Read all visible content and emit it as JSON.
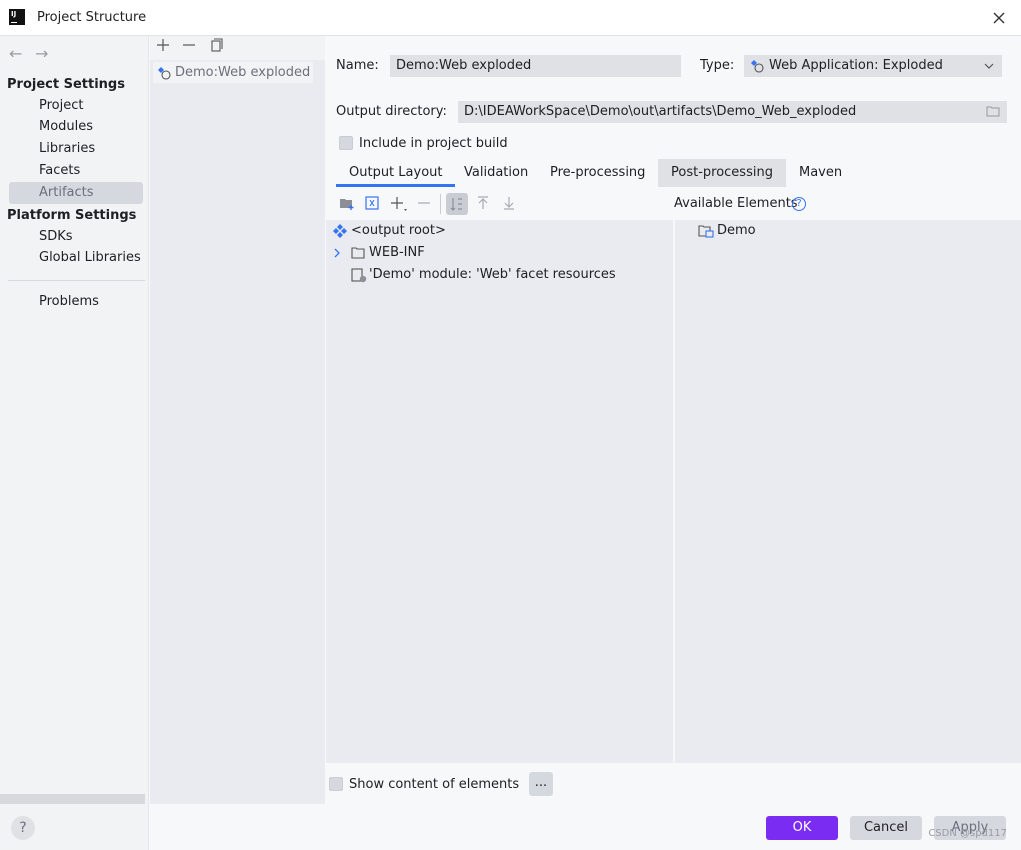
{
  "window": {
    "title": "Project Structure"
  },
  "nav": {
    "project_settings": "Project Settings",
    "project_items": [
      "Project",
      "Modules",
      "Libraries",
      "Facets",
      "Artifacts"
    ],
    "platform_settings": "Platform Settings",
    "platform_items": [
      "SDKs",
      "Global Libraries"
    ],
    "problems": "Problems",
    "selected": "Artifacts"
  },
  "artifact_list": {
    "items": [
      "Demo:Web exploded"
    ]
  },
  "form": {
    "name_label": "Name:",
    "name_value": "Demo:Web exploded",
    "type_label": "Type:",
    "type_value": "Web Application: Exploded",
    "output_label": "Output directory:",
    "output_value": "D:\\IDEAWorkSpace\\Demo\\out\\artifacts\\Demo_Web_exploded",
    "include_label": "Include in project build",
    "include_checked": false
  },
  "tabs": [
    {
      "label": "Output Layout",
      "active": true
    },
    {
      "label": "Validation",
      "active": false
    },
    {
      "label": "Pre-processing",
      "active": false
    },
    {
      "label": "Post-processing",
      "active": false
    },
    {
      "label": "Maven",
      "active": false
    }
  ],
  "layout_tree": [
    {
      "label": "<output root>",
      "icon": "output-root-icon"
    },
    {
      "label": "WEB-INF",
      "icon": "folder-icon",
      "expandable": true
    },
    {
      "label": "'Demo' module: 'Web' facet resources",
      "icon": "web-facet-icon"
    }
  ],
  "available": {
    "header": "Available Elements",
    "help": "?",
    "items": [
      "Demo"
    ]
  },
  "bottom": {
    "show_content_label": "Show content of elements",
    "dots": "...",
    "ok": "OK",
    "cancel": "Cancel",
    "apply": "Apply",
    "help": "?"
  },
  "watermark": "CSDN @spd117",
  "colors": {
    "accent": "#3574f0",
    "primary_button": "#7b2cf3",
    "selected_bg": "#d5d8de"
  }
}
